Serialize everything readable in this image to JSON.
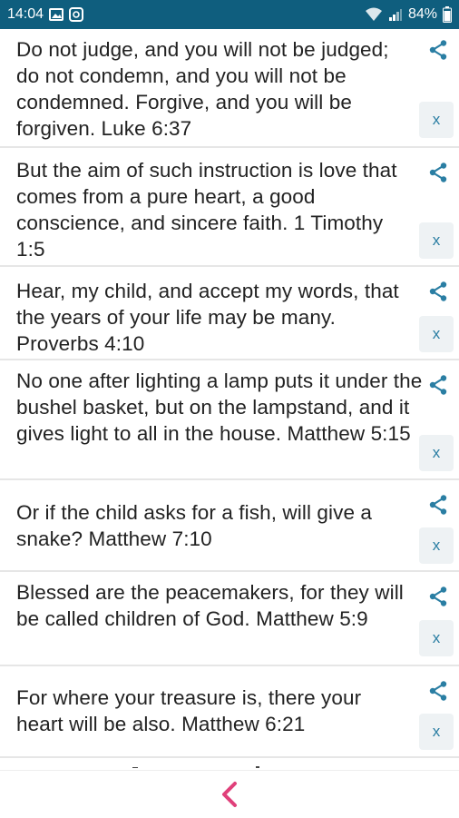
{
  "status_bar": {
    "time": "14:04",
    "battery": "84%",
    "icons": [
      "image-icon",
      "notification-icon",
      "wifi-icon",
      "signal-icon",
      "battery-icon"
    ]
  },
  "verses": [
    {
      "text": "Do not judge, and you will not be judged; do not condemn, and you will not be condemned. Forgive, and you will be forgiven.  Luke 6:37",
      "close_label": "x"
    },
    {
      "text": "But the aim of such instruction is love that comes from a pure heart, a good conscience, and sincere faith.  1 Timothy 1:5",
      "close_label": "x"
    },
    {
      "text": "Hear, my child, and accept my words, that the years of your life may be many.  Proverbs 4:10",
      "close_label": "x"
    },
    {
      "text": "No one after lighting a lamp puts it under the bushel basket, but on the lampstand, and it gives light to all in the house.  Matthew 5:15",
      "close_label": "x"
    },
    {
      "text": "Or if the child asks for a fish, will give a snake?  Matthew 7:10",
      "close_label": "x"
    },
    {
      "text": "Blessed are the peacemakers, for they will be called children of God.  Matthew 5:9",
      "close_label": "x"
    },
    {
      "text": "For where your treasure is, there your heart will be also.  Matthew 6:21",
      "close_label": "x"
    }
  ],
  "colors": {
    "status_bar": "#0f5e7e",
    "share_icon": "#2a7ea3",
    "back_icon": "#e0407a"
  },
  "bottom_bar": {
    "icon": "chevron-left-icon"
  }
}
